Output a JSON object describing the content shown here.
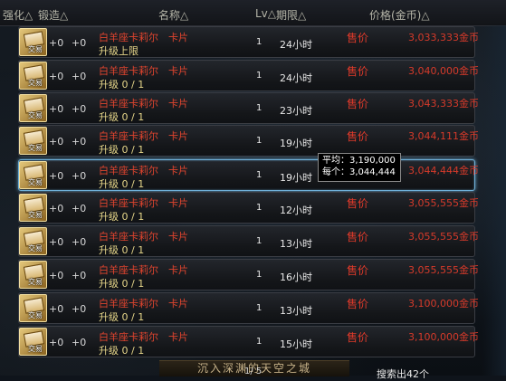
{
  "header": {
    "enhance": "强化△",
    "forge": "锻造△",
    "name": "名称△",
    "level": "Lv△",
    "period": "期限△",
    "price": "价格(金币)△"
  },
  "item_icon_label": "交易",
  "rows": [
    {
      "enhance": "+0",
      "forge": "+0",
      "name": "白羊座卡莉尔　卡片",
      "sub": "升级上限",
      "level": "1",
      "period": "24小时",
      "action": "售价",
      "price": "3,033,333金币"
    },
    {
      "enhance": "+0",
      "forge": "+0",
      "name": "白羊座卡莉尔　卡片",
      "sub": "升级 0 / 1",
      "level": "1",
      "period": "24小时",
      "action": "售价",
      "price": "3,040,000金币"
    },
    {
      "enhance": "+0",
      "forge": "+0",
      "name": "白羊座卡莉尔　卡片",
      "sub": "升级 0 / 1",
      "level": "1",
      "period": "23小时",
      "action": "售价",
      "price": "3,043,333金币"
    },
    {
      "enhance": "+0",
      "forge": "+0",
      "name": "白羊座卡莉尔　卡片",
      "sub": "升级 0 / 1",
      "level": "1",
      "period": "19小时",
      "action": "售价",
      "price": "3,044,111金币"
    },
    {
      "enhance": "+0",
      "forge": "+0",
      "name": "白羊座卡莉尔　卡片",
      "sub": "升级 0 / 1",
      "level": "1",
      "period": "19小时",
      "action": "售价",
      "price": "3,044,444金币"
    },
    {
      "enhance": "+0",
      "forge": "+0",
      "name": "白羊座卡莉尔　卡片",
      "sub": "升级 0 / 1",
      "level": "1",
      "period": "12小时",
      "action": "售价",
      "price": "3,055,555金币"
    },
    {
      "enhance": "+0",
      "forge": "+0",
      "name": "白羊座卡莉尔　卡片",
      "sub": "升级 0 / 1",
      "level": "1",
      "period": "13小时",
      "action": "售价",
      "price": "3,055,555金币"
    },
    {
      "enhance": "+0",
      "forge": "+0",
      "name": "白羊座卡莉尔　卡片",
      "sub": "升级 0 / 1",
      "level": "1",
      "period": "16小时",
      "action": "售价",
      "price": "3,055,555金币"
    },
    {
      "enhance": "+0",
      "forge": "+0",
      "name": "白羊座卡莉尔　卡片",
      "sub": "升级 0 / 1",
      "level": "1",
      "period": "13小时",
      "action": "售价",
      "price": "3,100,000金币"
    },
    {
      "enhance": "+0",
      "forge": "+0",
      "name": "白羊座卡莉尔　卡片",
      "sub": "升级 0 / 1",
      "level": "1",
      "period": "15小时",
      "action": "售价",
      "price": "3,100,000金币"
    }
  ],
  "tooltip": {
    "average": "平均：3,190,000",
    "each": "每个：3,044,444"
  },
  "footer": {
    "banner": "沉入深渊的天空之城",
    "pager": "1/ 5",
    "search_count": "搜索出42个"
  },
  "colors": {
    "name_red": "#e0442e",
    "sub_yellow": "#e6d68a",
    "price_red": "#d63a2a",
    "selected_border": "#6fb0d8"
  }
}
